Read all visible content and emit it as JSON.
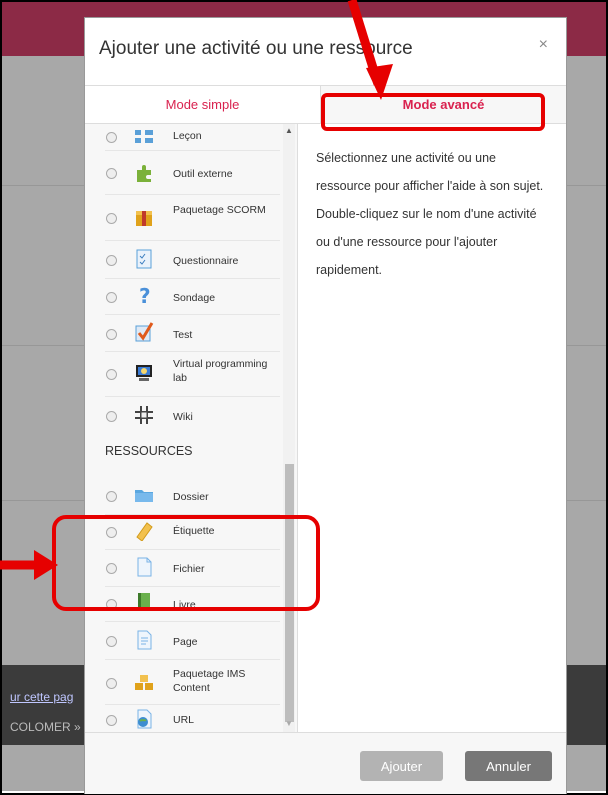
{
  "background": {
    "link_text": "ur cette pag",
    "breadcrumb_text": "COLOMER » ("
  },
  "modal": {
    "title": "Ajouter une activité ou une ressource",
    "close_label": "×",
    "tabs": [
      {
        "label": "Mode simple"
      },
      {
        "label": "Mode avancé"
      }
    ],
    "activities": [
      {
        "label": "Leçon",
        "icon": "lesson-icon"
      },
      {
        "label": "Outil externe",
        "icon": "puzzle-icon"
      },
      {
        "label": "Paquetage SCORM",
        "icon": "package-icon"
      },
      {
        "label": "Questionnaire",
        "icon": "questionnaire-icon"
      },
      {
        "label": "Sondage",
        "icon": "question-mark-icon"
      },
      {
        "label": "Test",
        "icon": "checkmark-icon"
      },
      {
        "label": "Virtual programming lab",
        "icon": "vpl-icon"
      },
      {
        "label": "Wiki",
        "icon": "wiki-icon"
      }
    ],
    "resources_heading": "RESSOURCES",
    "resources": [
      {
        "label": "Dossier",
        "icon": "folder-icon"
      },
      {
        "label": "Étiquette",
        "icon": "label-tag-icon"
      },
      {
        "label": "Fichier",
        "icon": "file-icon"
      },
      {
        "label": "Livre",
        "icon": "book-icon"
      },
      {
        "label": "Page",
        "icon": "page-icon"
      },
      {
        "label": "Paquetage IMS Content",
        "icon": "ims-package-icon"
      },
      {
        "label": "URL",
        "icon": "url-globe-icon"
      }
    ],
    "help_text": "Sélectionnez une activité ou une ressource pour afficher l'aide à son sujet. Double-cliquez sur le nom d'une activité ou d'une ressource pour l'ajouter rapidement.",
    "buttons": {
      "add": "Ajouter",
      "cancel": "Annuler"
    }
  },
  "colors": {
    "accent": "#d9224f",
    "annotation": "#e60000"
  }
}
